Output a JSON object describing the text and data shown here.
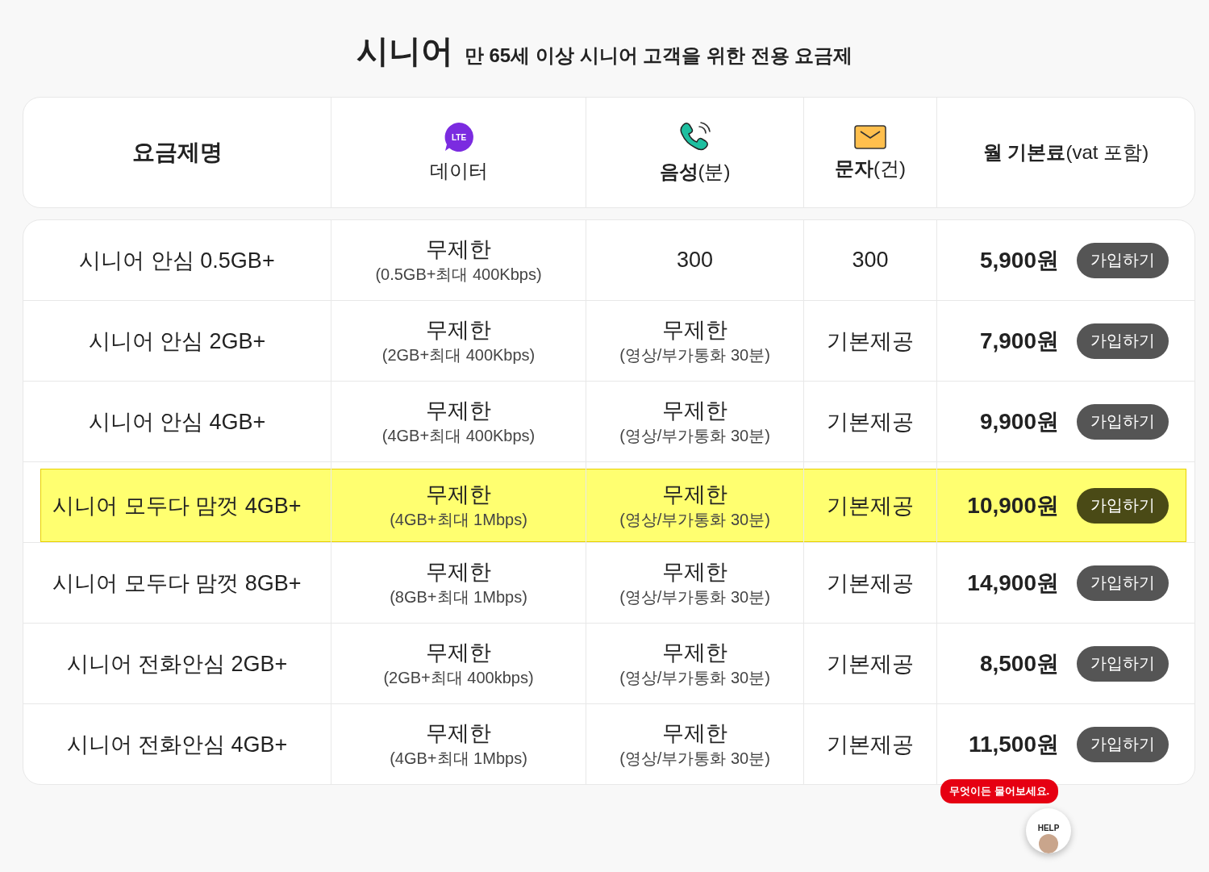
{
  "title": {
    "main": "시니어",
    "subtitle": "만 65세 이상 시니어 고객을 위한 전용 요금제"
  },
  "columns": [
    {
      "kind": "plain",
      "label": "요금제명"
    },
    {
      "kind": "data",
      "label": "데이터",
      "icon_text": "LTE"
    },
    {
      "kind": "voice",
      "label": "**음성**(분)"
    },
    {
      "kind": "sms",
      "label": "**문자**(건)"
    },
    {
      "kind": "plain",
      "label": "**월 기본료**(vat 포함)"
    }
  ],
  "rows": [
    {
      "name": "시니어 안심 0.5GB+",
      "data": "무제한",
      "data_note": "(0.5GB+최대 400Kbps)",
      "voice": "300",
      "sms": "300",
      "price": "5,900원",
      "button": "가입하기",
      "selected": false
    },
    {
      "name": "시니어 안심 2GB+",
      "data": "무제한",
      "data_note": "(2GB+최대 400Kbps)",
      "voice": "무제한",
      "voice_note": "(영상/부가통화 30분)",
      "sms": "기본제공",
      "price": "7,900원",
      "button": "가입하기",
      "selected": false
    },
    {
      "name": "시니어 안심 4GB+",
      "data": "무제한",
      "data_note": "(4GB+최대 400Kbps)",
      "voice": "무제한",
      "voice_note": "(영상/부가통화 30분)",
      "sms": "기본제공",
      "price": "9,900원",
      "button": "가입하기",
      "selected": false
    },
    {
      "name": "시니어 모두다 맘껏 4GB+",
      "data": "무제한",
      "data_note": "(4GB+최대 1Mbps)",
      "voice": "무제한",
      "voice_note": "(영상/부가통화 30분)",
      "sms": "기본제공",
      "price": "10,900원",
      "button": "가입하기",
      "selected": true
    },
    {
      "name": "시니어 모두다 맘껏 8GB+",
      "data": "무제한",
      "data_note": "(8GB+최대 1Mbps)",
      "voice": "무제한",
      "voice_note": "(영상/부가통화 30분)",
      "sms": "기본제공",
      "price": "14,900원",
      "button": "가입하기",
      "selected": false
    },
    {
      "name": "시니어 전화안심 2GB+",
      "data": "무제한",
      "data_note": "(2GB+최대 400kbps)",
      "voice": "무제한",
      "voice_note": "(영상/부가통화 30분)",
      "sms": "기본제공",
      "price": "8,500원",
      "button": "가입하기",
      "selected": false
    },
    {
      "name": "시니어 전화안심 4GB+",
      "data": "무제한",
      "data_note": "(4GB+최대 1Mbps)",
      "voice": "무제한",
      "voice_note": "(영상/부가통화 30분)",
      "sms": "기본제공",
      "price": "11,500원",
      "button": "가입하기",
      "selected": false
    }
  ],
  "help": {
    "bubble": "무엇이든 물어보세요.",
    "badge": "HELP"
  }
}
